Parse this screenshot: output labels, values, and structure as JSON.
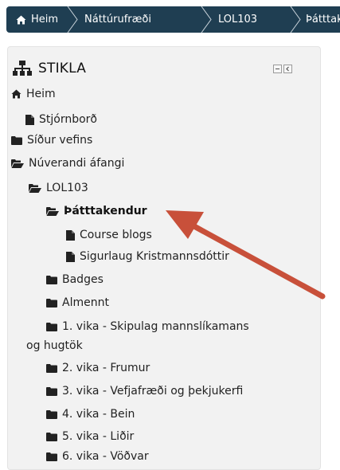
{
  "breadcrumb": {
    "items": [
      {
        "label": "Heim"
      },
      {
        "label": "Náttúrufræði"
      },
      {
        "label": "LOL103"
      },
      {
        "label": "Þátttakendur"
      }
    ]
  },
  "navigation_block": {
    "title": "STIKLA",
    "nodes": [
      {
        "label": "Heim",
        "icon": "home-icon"
      },
      {
        "label": "Stjórnborð",
        "icon": "file-icon"
      },
      {
        "label": "Síður vefins",
        "icon": "folder-icon"
      },
      {
        "label": "Núverandi áfangi",
        "icon": "folder-open-icon"
      },
      {
        "label": "LOL103",
        "icon": "folder-open-icon"
      },
      {
        "label": "Þátttakendur",
        "icon": "folder-open-icon",
        "active": true
      },
      {
        "label": "Course blogs",
        "icon": "file-icon"
      },
      {
        "label": "Sigurlaug Kristmannsdóttir",
        "icon": "file-icon"
      },
      {
        "label": "Badges",
        "icon": "folder-icon"
      },
      {
        "label": "Almennt",
        "icon": "folder-icon"
      },
      {
        "label": "1. vika - Skipulag mannslíkamans",
        "label_cont": "og hugtök",
        "icon": "folder-icon"
      },
      {
        "label": "2. vika - Frumur",
        "icon": "folder-icon"
      },
      {
        "label": "3. vika - Vefjafræði og þekjukerfi",
        "icon": "folder-icon"
      },
      {
        "label": "4. vika - Bein",
        "icon": "folder-icon"
      },
      {
        "label": "5. vika - Liðir",
        "icon": "folder-icon"
      },
      {
        "label": "6. vika - Vöðvar",
        "icon": "folder-icon"
      }
    ]
  },
  "colors": {
    "breadcrumb_bg": "#1f3e52",
    "block_bg": "#f2f2f2",
    "annotation_arrow": "#c8503a"
  }
}
